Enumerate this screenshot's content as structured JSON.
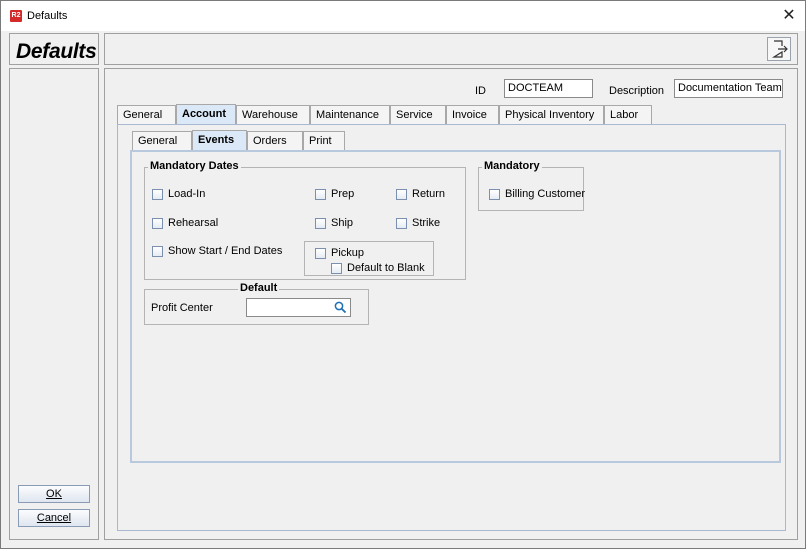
{
  "window": {
    "title": "Defaults",
    "app_icon_text": "R2",
    "close_glyph": "✕"
  },
  "left": {
    "title": "Defaults",
    "ok_label": "OK",
    "cancel_label": "Cancel"
  },
  "header": {
    "id_label": "ID",
    "id_value": "DOCTEAM",
    "description_label": "Description",
    "description_value": "Documentation Team"
  },
  "tabs": [
    "General",
    "Account",
    "Warehouse",
    "Maintenance",
    "Service",
    "Invoice",
    "Physical Inventory",
    "Labor"
  ],
  "subtabs": [
    "General",
    "Events",
    "Orders",
    "Print"
  ],
  "mandatory_dates": {
    "title": "Mandatory Dates",
    "load_in": "Load-In",
    "rehearsal": "Rehearsal",
    "show_dates": "Show Start / End Dates",
    "prep": "Prep",
    "ship": "Ship",
    "return": "Return",
    "strike": "Strike",
    "pickup": "Pickup",
    "default_blank": "Default to Blank"
  },
  "mandatory": {
    "title": "Mandatory",
    "billing_customer": "Billing Customer"
  },
  "default_group": {
    "title": "Default",
    "profit_center_label": "Profit Center",
    "profit_center_value": ""
  }
}
